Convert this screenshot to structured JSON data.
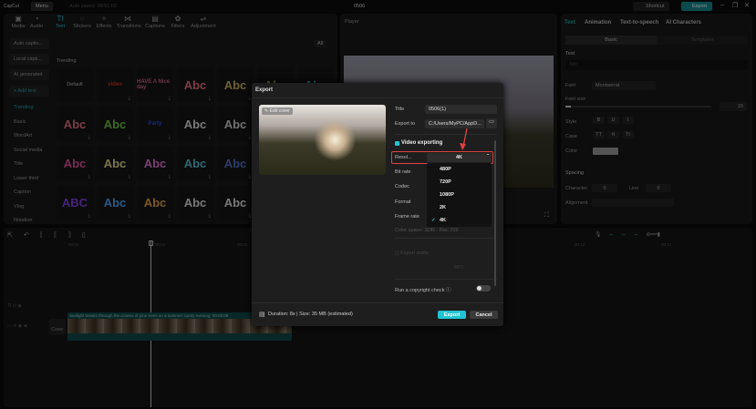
{
  "titlebar": {
    "logo": "CapCut",
    "menu": "Menu",
    "autosave": "Auto saved: 09:51:02",
    "project": "0506",
    "shortcut": "Shortcut",
    "export": "Export"
  },
  "media_tabs": [
    {
      "icon": "media-icon",
      "glyph": "▣",
      "label": "Media"
    },
    {
      "icon": "audio-icon",
      "glyph": "◔",
      "label": "Audio"
    },
    {
      "icon": "text-icon",
      "glyph": "TI",
      "label": "Text"
    },
    {
      "icon": "stickers-icon",
      "glyph": "◌",
      "label": "Stickers"
    },
    {
      "icon": "effects-icon",
      "glyph": "✧",
      "label": "Effects"
    },
    {
      "icon": "transitions-icon",
      "glyph": "⋈",
      "label": "Transitions"
    },
    {
      "icon": "captions-icon",
      "glyph": "▤",
      "label": "Captions"
    },
    {
      "icon": "filters-icon",
      "glyph": "✿",
      "label": "Filters"
    },
    {
      "icon": "adjustment-icon",
      "glyph": "⇌",
      "label": "Adjustment"
    }
  ],
  "text_sidebar": [
    "Auto captio...",
    "Local capti...",
    "AI generated",
    "+ Add text",
    "Trending",
    "Basic",
    "WordArt",
    "Social media",
    "Title",
    "Lower third",
    "Caption",
    "Vlog",
    "Notation"
  ],
  "filter_all": "All",
  "section": "Trending",
  "text_styles": [
    {
      "label": "Default",
      "color": "#bbb"
    },
    {
      "label": "video",
      "color": "#c0392b"
    },
    {
      "label": "HAVE A Nice day",
      "color": "#d06080"
    },
    {
      "label": "Abc",
      "color": "#e07080"
    },
    {
      "label": "Abc",
      "color": "#c8b060"
    },
    {
      "label": "Abc",
      "color": "#d4d020"
    },
    {
      "label": "Abc",
      "color": "#40c0c0"
    },
    {
      "label": "Abc",
      "color": "#e07080"
    },
    {
      "label": "Abc",
      "color": "#70c040"
    },
    {
      "label": "Party",
      "color": "#3050e0"
    },
    {
      "label": "Abc",
      "color": "#ddd"
    },
    {
      "label": "Abc",
      "color": "#ccc"
    },
    {
      "label": "Abc",
      "color": "#dd5"
    },
    {
      "label": "Abc",
      "color": "#e7e"
    },
    {
      "label": "Abc",
      "color": "#e050a0"
    },
    {
      "label": "Abc",
      "color": "#e8d890"
    },
    {
      "label": "Abc",
      "color": "#e070d0"
    },
    {
      "label": "Abc",
      "color": "#50c0d0"
    },
    {
      "label": "Abc",
      "color": "#5070c0"
    },
    {
      "label": "Abc",
      "color": "#bbb"
    },
    {
      "label": "Abc",
      "color": "#4080e0"
    },
    {
      "label": "ABC",
      "color": "#8040e0"
    },
    {
      "label": "Abc",
      "color": "#50a0f0"
    },
    {
      "label": "Abc",
      "color": "#e0a040"
    },
    {
      "label": "Abc",
      "color": "#ddd"
    },
    {
      "label": "Abc",
      "color": "#ddd"
    },
    {
      "label": "Abc",
      "color": "#ddd"
    },
    {
      "label": "Abc",
      "color": "#ddd"
    }
  ],
  "player": {
    "title": "Player"
  },
  "right_panel": {
    "tabs": [
      "Text",
      "Animation",
      "Text-to-speech",
      "AI Characters"
    ],
    "subtabs": [
      "Basic",
      "Templates"
    ],
    "text_heading": "Text",
    "text_placeholder": "Abc",
    "font_label": "Font",
    "font_value": "Montserrat",
    "font_size_label": "Font size",
    "font_size": "15",
    "style_label": "Style",
    "style_buttons": [
      "B",
      "U",
      "I"
    ],
    "case_label": "Case",
    "case_buttons": [
      "TT",
      "tt",
      "Tt"
    ],
    "color_label": "Color",
    "spacing_label": "Spacing",
    "character_label": "Character",
    "character_value": "0",
    "line_label": "Line",
    "line_value": "0",
    "alignment_label": "Alignment"
  },
  "timeline": {
    "ticks": [
      "00:00",
      "00:02",
      "00:04",
      "00:12",
      "00:14"
    ],
    "clip_caption": "Sunlight breaks through the crowns of pine trees on a summer sunny evening",
    "clip_time": "00:00:08",
    "cover": "Cover"
  },
  "export_dialog": {
    "title": "Export",
    "edit_cover": "Edit cover",
    "title_label": "Title",
    "title_value": "0506(1)",
    "export_to_label": "Export to",
    "export_to_value": "C:/Users/MyPC/AppD...",
    "video_exporting": "Video exporting",
    "resolution_label": "Resol...",
    "resolution_value": "4K",
    "bitrate_label": "Bit rate",
    "codec_label": "Codec",
    "format_label": "Format",
    "framerate_label": "Frame rate",
    "color_space": "Color space: SDR - Rec.709",
    "export_audio": "Export audio",
    "audio_format": "MP3",
    "copyright": "Run a copyright check",
    "copyright_on": false,
    "resolution_options": [
      "480P",
      "720P",
      "1080P",
      "2K",
      "4K"
    ],
    "selected": "4K",
    "footer_info": "Duration: 8s | Size: 35 MB (estimated)",
    "export_button": "Export",
    "cancel_button": "Cancel",
    "accent": "#20c4d4",
    "highlight": "#e04040"
  }
}
